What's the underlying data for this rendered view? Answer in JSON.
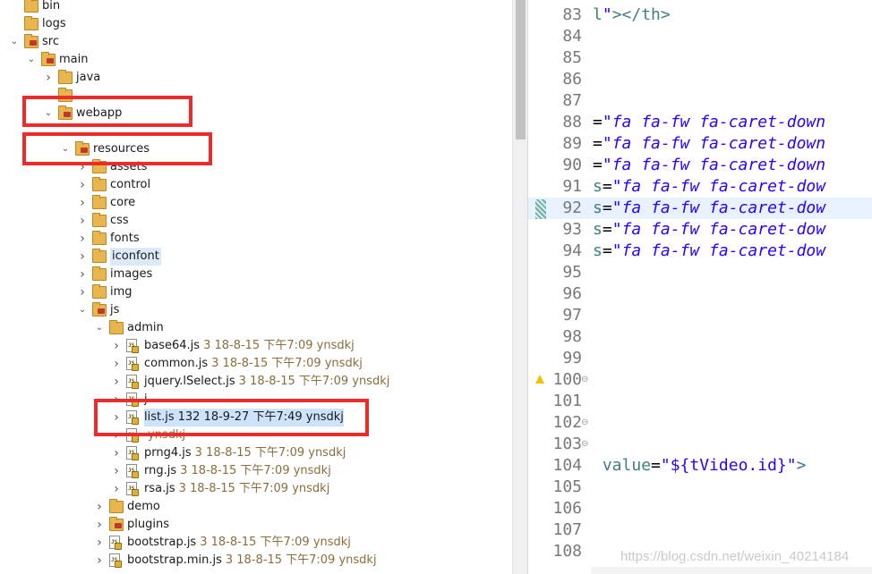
{
  "tree": [
    {
      "label": "bin",
      "indent": 0,
      "chevron": "",
      "icon": "folder"
    },
    {
      "label": "logs",
      "indent": 0,
      "chevron": "",
      "icon": "folder"
    },
    {
      "label": "src",
      "indent": 0,
      "chevron": "expanded",
      "icon": "folder-pkg"
    },
    {
      "label": "main",
      "indent": 1,
      "chevron": "expanded",
      "icon": "folder-pkg"
    },
    {
      "label": "java",
      "indent": 2,
      "chevron": "collapsed",
      "icon": "folder"
    },
    {
      "label": "",
      "indent": 2,
      "chevron": "",
      "icon": "folder"
    },
    {
      "label": "webapp",
      "indent": 2,
      "chevron": "expanded",
      "icon": "folder-pkg"
    },
    {
      "label": "",
      "indent": 3,
      "chevron": "",
      "icon": ""
    },
    {
      "label": "resources",
      "indent": 3,
      "chevron": "expanded",
      "icon": "folder-pkg"
    },
    {
      "label": "assets",
      "indent": 4,
      "chevron": "collapsed",
      "icon": "folder"
    },
    {
      "label": "control",
      "indent": 4,
      "chevron": "collapsed",
      "icon": "folder"
    },
    {
      "label": "core",
      "indent": 4,
      "chevron": "collapsed",
      "icon": "folder"
    },
    {
      "label": "css",
      "indent": 4,
      "chevron": "collapsed",
      "icon": "folder"
    },
    {
      "label": "fonts",
      "indent": 4,
      "chevron": "collapsed",
      "icon": "folder"
    },
    {
      "label": "iconfont",
      "indent": 4,
      "chevron": "collapsed",
      "icon": "folder",
      "hover": true
    },
    {
      "label": "images",
      "indent": 4,
      "chevron": "collapsed",
      "icon": "folder"
    },
    {
      "label": "img",
      "indent": 4,
      "chevron": "collapsed",
      "icon": "folder"
    },
    {
      "label": "js",
      "indent": 4,
      "chevron": "expanded",
      "icon": "folder-pkg"
    },
    {
      "label": "admin",
      "indent": 5,
      "chevron": "expanded",
      "icon": "folder"
    },
    {
      "label": "base64.js",
      "indent": 6,
      "chevron": "collapsed",
      "icon": "js",
      "meta": "3   18-8-15 下午7:09   ynsdkj"
    },
    {
      "label": "common.js",
      "indent": 6,
      "chevron": "collapsed",
      "icon": "js",
      "meta": "3   18-8-15 下午7:09   ynsdkj"
    },
    {
      "label": "jquery.lSelect.js",
      "indent": 6,
      "chevron": "collapsed",
      "icon": "js",
      "meta": "3   18-8-15 下午7:09   ynsdkj"
    },
    {
      "label": "j",
      "indent": 6,
      "chevron": "collapsed",
      "icon": "js",
      "meta": ""
    },
    {
      "label": "list.js",
      "indent": 6,
      "chevron": "collapsed",
      "icon": "js",
      "meta": "132   18-9-27 下午7:49   ynsdkj",
      "selected": true
    },
    {
      "label": "",
      "indent": 6,
      "chevron": "collapsed",
      "icon": "js",
      "meta": "ynsdkj"
    },
    {
      "label": "prng4.js",
      "indent": 6,
      "chevron": "collapsed",
      "icon": "js",
      "meta": "3   18-8-15 下午7:09   ynsdkj"
    },
    {
      "label": "rng.js",
      "indent": 6,
      "chevron": "collapsed",
      "icon": "js",
      "meta": "3   18-8-15 下午7:09   ynsdkj"
    },
    {
      "label": "rsa.js",
      "indent": 6,
      "chevron": "collapsed",
      "icon": "js",
      "meta": "3   18-8-15 下午7:09   ynsdkj"
    },
    {
      "label": "demo",
      "indent": 5,
      "chevron": "collapsed",
      "icon": "folder"
    },
    {
      "label": "plugins",
      "indent": 5,
      "chevron": "collapsed",
      "icon": "folder-pkg"
    },
    {
      "label": "bootstrap.js",
      "indent": 5,
      "chevron": "collapsed",
      "icon": "js",
      "meta": "3   18-8-15 下午7:09   ynsdkj"
    },
    {
      "label": "bootstrap.min.js",
      "indent": 5,
      "chevron": "collapsed",
      "icon": "js",
      "meta": "3   18-8-15 下午7:09   ynsdkj"
    }
  ],
  "editor": {
    "lines": [
      {
        "num": "83",
        "code": [
          [
            "attr",
            "l"
          ],
          [
            "str",
            "\""
          ],
          [
            "tag",
            "></th>"
          ]
        ]
      },
      {
        "num": "84",
        "code": []
      },
      {
        "num": "85",
        "code": []
      },
      {
        "num": "86",
        "code": []
      },
      {
        "num": "87",
        "code": []
      },
      {
        "num": "88",
        "code": [
          [
            "plain",
            "="
          ],
          [
            "str",
            "\"fa fa-fw fa-caret-down"
          ]
        ]
      },
      {
        "num": "89",
        "code": [
          [
            "plain",
            "="
          ],
          [
            "str",
            "\"fa fa-fw fa-caret-down"
          ]
        ]
      },
      {
        "num": "90",
        "code": [
          [
            "plain",
            "="
          ],
          [
            "str",
            "\"fa fa-fw fa-caret-down"
          ]
        ]
      },
      {
        "num": "91",
        "code": [
          [
            "attr",
            "s"
          ],
          [
            "plain",
            "="
          ],
          [
            "str",
            "\"fa fa-fw fa-caret-dow"
          ]
        ]
      },
      {
        "num": "92",
        "code": [
          [
            "attr",
            "s"
          ],
          [
            "plain",
            "="
          ],
          [
            "str",
            "\"fa fa-fw fa-caret-dow"
          ]
        ],
        "current": true
      },
      {
        "num": "93",
        "code": [
          [
            "attr",
            "s"
          ],
          [
            "plain",
            "="
          ],
          [
            "str",
            "\"fa fa-fw fa-caret-dow"
          ]
        ]
      },
      {
        "num": "94",
        "code": [
          [
            "attr",
            "s"
          ],
          [
            "plain",
            "="
          ],
          [
            "str",
            "\"fa fa-fw fa-caret-dow"
          ]
        ]
      },
      {
        "num": "95",
        "code": []
      },
      {
        "num": "96",
        "code": []
      },
      {
        "num": "97",
        "code": []
      },
      {
        "num": "98",
        "code": []
      },
      {
        "num": "99",
        "code": []
      },
      {
        "num": "100",
        "code": [],
        "warning": true,
        "fold": "⊖"
      },
      {
        "num": "101",
        "code": []
      },
      {
        "num": "102",
        "code": [],
        "fold": "⊖"
      },
      {
        "num": "103",
        "code": [],
        "fold": "⊖"
      },
      {
        "num": "104",
        "code": [
          [
            "plain",
            " "
          ],
          [
            "attr",
            "value"
          ],
          [
            "plain",
            "="
          ],
          [
            "strn",
            "\"${tVideo.id}\""
          ],
          [
            "tagb",
            ">"
          ]
        ]
      },
      {
        "num": "105",
        "code": []
      },
      {
        "num": "106",
        "code": []
      },
      {
        "num": "107",
        "code": []
      },
      {
        "num": "108",
        "code": []
      }
    ]
  },
  "watermark": "https://blog.csdn.net/weixin_40214184",
  "colors": {
    "annotation": "#ee2b2b",
    "selection": "#cde3fb"
  }
}
